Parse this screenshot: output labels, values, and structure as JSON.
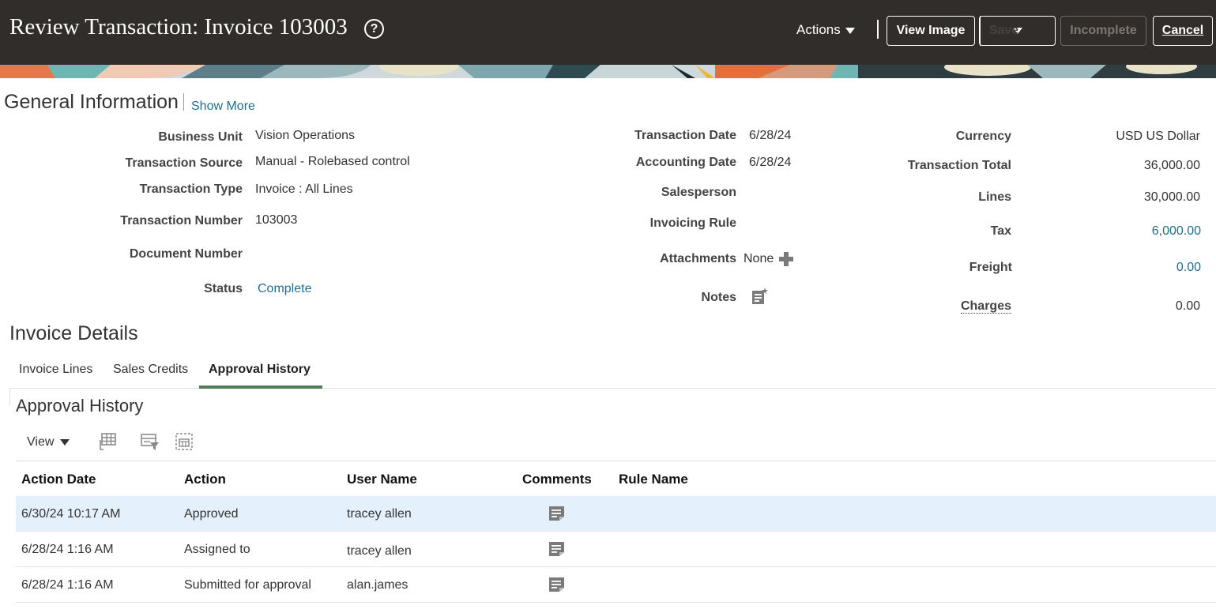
{
  "header": {
    "title": "Review Transaction: Invoice 103003",
    "help_icon_glyph": "?",
    "actions_label": "Actions",
    "view_image_label": "View Image",
    "save_label": "Save",
    "incomplete_label": "Incomplete",
    "cancel_label": "Cancel",
    "background_color": "#312d2a"
  },
  "general_information": {
    "title": "General Information",
    "show_more": "Show More",
    "fields_left": {
      "business_unit": {
        "label": "Business Unit",
        "value": "Vision Operations"
      },
      "transaction_source": {
        "label": "Transaction Source",
        "value": "Manual - Rolebased control"
      },
      "transaction_type": {
        "label": "Transaction Type",
        "value": "Invoice : All Lines"
      },
      "transaction_number": {
        "label": "Transaction Number",
        "value": "103003"
      },
      "document_number": {
        "label": "Document Number",
        "value": ""
      },
      "status": {
        "label": "Status",
        "value": "Complete"
      }
    },
    "fields_middle": {
      "transaction_date": {
        "label": "Transaction Date",
        "value": "6/28/24"
      },
      "accounting_date": {
        "label": "Accounting Date",
        "value": "6/28/24"
      },
      "salesperson": {
        "label": "Salesperson",
        "value": ""
      },
      "invoicing_rule": {
        "label": "Invoicing Rule",
        "value": ""
      },
      "attachments": {
        "label": "Attachments",
        "value": "None"
      },
      "notes": {
        "label": "Notes",
        "value": ""
      }
    },
    "fields_right": {
      "currency": {
        "label": "Currency",
        "value": "USD US Dollar"
      },
      "transaction_total": {
        "label": "Transaction Total",
        "value": "36,000.00"
      },
      "lines": {
        "label": "Lines",
        "value": "30,000.00"
      },
      "tax": {
        "label": "Tax",
        "value": "6,000.00"
      },
      "freight": {
        "label": "Freight",
        "value": "0.00"
      },
      "charges": {
        "label": "Charges",
        "value": "0.00"
      }
    },
    "link_color": "#1f6f8b"
  },
  "invoice_details": {
    "title": "Invoice Details",
    "tabs": [
      {
        "label": "Invoice Lines",
        "active": false
      },
      {
        "label": "Sales Credits",
        "active": false
      },
      {
        "label": "Approval History",
        "active": true
      }
    ],
    "active_tab_color": "#4f7d54"
  },
  "approval_history": {
    "title": "Approval History",
    "view_label": "View",
    "toolbar_icons": [
      "freeze-columns-icon",
      "query-by-example-icon",
      "detach-icon"
    ],
    "columns": [
      "Action Date",
      "Action",
      "User Name",
      "Comments",
      "Rule Name"
    ],
    "rows": [
      {
        "action_date": "6/30/24 10:17 AM",
        "action": "Approved",
        "user_name": "tracey allen",
        "comments_icon": "comment-icon",
        "rule_name": "",
        "selected": true
      },
      {
        "action_date": "6/28/24 1:16 AM",
        "action": "Assigned to",
        "user_name": "tracey allen",
        "comments_icon": "comment-icon",
        "rule_name": "",
        "selected": false
      },
      {
        "action_date": "6/28/24 1:16 AM",
        "action": "Submitted for approval",
        "user_name": "alan.james",
        "comments_icon": "comment-icon",
        "rule_name": "",
        "selected": false
      }
    ],
    "selected_row_color": "#e4f0fb"
  }
}
